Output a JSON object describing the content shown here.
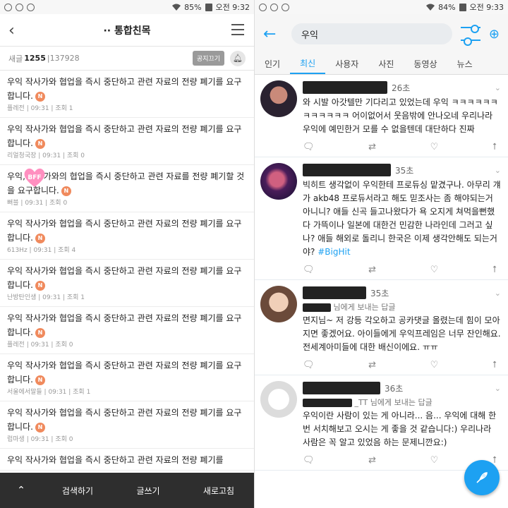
{
  "left": {
    "status": {
      "battery": "85%",
      "time": "오전 9:32"
    },
    "header": {
      "title": "·· 통합친목"
    },
    "subheader": {
      "label": "새글",
      "count": "1255",
      "total": "137928",
      "notice_button": "공지끄기"
    },
    "posts": [
      {
        "text": "우익 작사가와 협업을 즉시 중단하고 관련 자료의 전량 폐기를 요구합니다.",
        "author": "플레전",
        "time": "09:31",
        "views": "조회 1"
      },
      {
        "text": "우익 작사가와 협업을 즉시 중단하고 관련 자료의 전량 폐기를 요구합니다.",
        "author": "리얼청국장",
        "time": "09:31",
        "views": "조회 0"
      },
      {
        "text": "우익, 작사가와의 협업을 즉시 중단하고 관련 자료를 전량 폐기할 것을 요구합니다.",
        "author": "뻐블",
        "time": "09:31",
        "views": "조회 0",
        "sticker": "BFF"
      },
      {
        "text": "우익 작사가와 협업을 즉시 중단하고 관련 자료의 전량 폐기를 요구합니다.",
        "author": "613Hz",
        "time": "09:31",
        "views": "조회 4"
      },
      {
        "text": "우익 작사가와 협업을 즉시 중단하고 관련 자료의 전량 폐기를 요구합니다.",
        "author": "난방탄인생",
        "time": "09:31",
        "views": "조회 1"
      },
      {
        "text": "우익 작사가와 협업을 즉시 중단하고 관련 자료의 전량 폐기를 요구합니다.",
        "author": "플레전",
        "time": "09:31",
        "views": "조회 0"
      },
      {
        "text": "우익 작사가와 협업을 즉시 중단하고 관련 자료의 전량 폐기를 요구합니다.",
        "author": "서울에서말들",
        "time": "09:31",
        "views": "조회 1"
      },
      {
        "text": "우익 작사가와 협업을 즉시 중단하고 관련 자료의 전량 폐기를 요구합니다.",
        "author": "럽마생",
        "time": "09:31",
        "views": "조회 0"
      },
      {
        "text": "우익 작사가와 협업을 즉시 중단하고 관련 자료의 전량 폐기를",
        "author": "",
        "time": "",
        "views": ""
      }
    ],
    "new_badge": "N",
    "bottom": {
      "search": "검색하기",
      "write": "글쓰기",
      "refresh": "새로고침"
    }
  },
  "right": {
    "status": {
      "battery": "84%",
      "time": "오전 9:33"
    },
    "search": {
      "query": "우익"
    },
    "tabs": [
      "인기",
      "최신",
      "사용자",
      "사진",
      "동영상",
      "뉴스"
    ],
    "active_tab": "최신",
    "tweets": [
      {
        "time": "26초",
        "reply_to": "",
        "text": "와 시발 아갓텔만 기다리고 있었는데 우익 ㅋㅋㅋㅋㅋㅋㅋㅋㅋㅋㅋㅋ 어이없어서 웃음밖에 안나오네 우리나라 우익에 예민한거 모를 수 없을텐데 대단하다 진짜"
      },
      {
        "time": "35초",
        "reply_to": "",
        "text": "빅히트 생각없이 우익한테 프로듀싱 맡겼구나. 아무리 걔가 akb48 프로듀서라고 해도 믿조사는 좀 해야되는거 아니니? 애들 신곡 들고나왔다가 욕 오지게 쳐먹을뻔했다 가뜩이나 일본에 대한건 민감한 나라인데 그러고 싶나? 애들 해외로 돌리니 한국은 이제 생각안해도 되는거야?",
        "hashtag": "#BigHit"
      },
      {
        "time": "35초",
        "reply_to": "님에게 보내는 답글",
        "text": "면지님~ 저 강등 각오하고 공카댓글 올렸는데 힘이 모아지면 좋겠어요. 아이들에게 우익프레임은 너무 잔인해요. 전세계아미들에 대한 배신이에요. ㅠㅠ"
      },
      {
        "time": "36초",
        "reply_to": "_TT 님에게 보내는 답글",
        "text": "우익이란 사람이 있는 게 아니라... 음... 우익에 대해 한번 서치해보고 오시는 게 좋을 것 같습니다:) 우리나라 사람은 꼭 알고 있었음 하는 문제니깐요:)"
      }
    ]
  }
}
